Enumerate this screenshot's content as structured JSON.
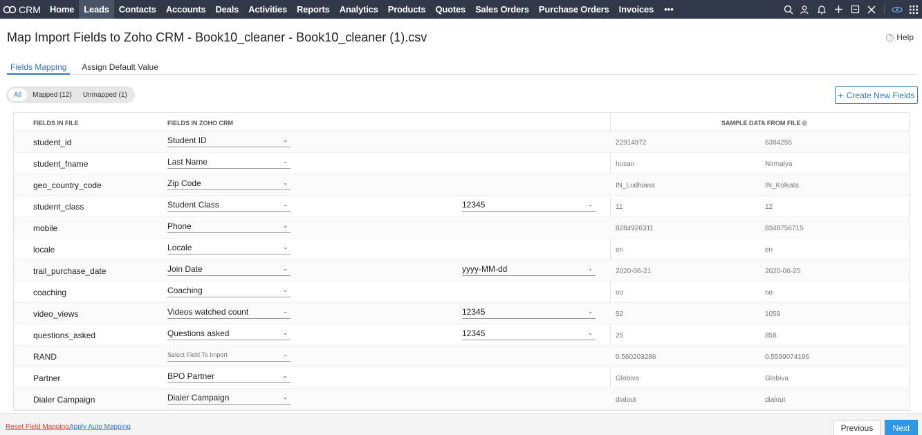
{
  "nav": {
    "brand": "CRM",
    "items": [
      {
        "label": "Home",
        "active": false
      },
      {
        "label": "Leads",
        "active": true
      },
      {
        "label": "Contacts",
        "active": false
      },
      {
        "label": "Accounts",
        "active": false
      },
      {
        "label": "Deals",
        "active": false
      },
      {
        "label": "Activities",
        "active": false
      },
      {
        "label": "Reports",
        "active": false
      },
      {
        "label": "Analytics",
        "active": false
      },
      {
        "label": "Products",
        "active": false
      },
      {
        "label": "Quotes",
        "active": false
      },
      {
        "label": "Sales Orders",
        "active": false
      },
      {
        "label": "Purchase Orders",
        "active": false
      },
      {
        "label": "Invoices",
        "active": false
      }
    ],
    "more": "•••",
    "icons": [
      "search-icon",
      "user-settings-icon",
      "bell-icon",
      "plus-icon",
      "calendar-icon",
      "tools-icon",
      "eye-link-icon",
      "apps-grid-icon"
    ]
  },
  "page": {
    "title": "Map Import Fields to Zoho CRM - Book10_cleaner - Book10_cleaner (1).csv",
    "help": "Help"
  },
  "tabs": [
    {
      "label": "Fields Mapping",
      "active": true
    },
    {
      "label": "Assign Default Value",
      "active": false
    }
  ],
  "filters": [
    {
      "label": "All",
      "active": true
    },
    {
      "label": "Mapped (12)",
      "active": false
    },
    {
      "label": "Unmapped (1)",
      "active": false
    }
  ],
  "create_button": "Create New Fields",
  "table": {
    "headers": {
      "file": "FIELDS IN FILE",
      "crm": "FIELDS IN ZOHO CRM",
      "sample": "SAMPLE DATA FROM FILE"
    },
    "rows": [
      {
        "file": "student_id",
        "crm": "Student ID",
        "format": "",
        "s1": "22914972",
        "s2": "6384255"
      },
      {
        "file": "student_fname",
        "crm": "Last Name",
        "format": "",
        "s1": "husan",
        "s2": "Nirmalya"
      },
      {
        "file": "geo_country_code",
        "crm": "Zip Code",
        "format": "",
        "s1": "IN_Ludhiana",
        "s2": "IN_Kolkata"
      },
      {
        "file": "student_class",
        "crm": "Student Class",
        "format": "12345",
        "s1": "11",
        "s2": "12"
      },
      {
        "file": "mobile",
        "crm": "Phone",
        "format": "",
        "s1": "8284926311",
        "s2": "8348756715"
      },
      {
        "file": "locale",
        "crm": "Locale",
        "format": "",
        "s1": "en",
        "s2": "en"
      },
      {
        "file": "trail_purchase_date",
        "crm": "Join Date",
        "format": "yyyy-MM-dd",
        "s1": "2020-06-21",
        "s2": "2020-06-25"
      },
      {
        "file": "coaching",
        "crm": "Coaching",
        "format": "",
        "s1": "no",
        "s2": "no"
      },
      {
        "file": "video_views",
        "crm": "Videos watched count",
        "format": "12345",
        "s1": "52",
        "s2": "1059"
      },
      {
        "file": "questions_asked",
        "crm": "Questions asked",
        "format": "12345",
        "s1": "25",
        "s2": "858"
      },
      {
        "file": "RAND",
        "crm": "",
        "placeholder": "Select Field To Import",
        "format": "",
        "s1": "0.560203286",
        "s2": "0.5599074196"
      },
      {
        "file": "Partner",
        "crm": "BPO Partner",
        "format": "",
        "s1": "Globiva",
        "s2": "Globiva"
      },
      {
        "file": "Dialer Campaign",
        "crm": "Dialer Campaign",
        "format": "",
        "s1": "dialout",
        "s2": "dialout"
      }
    ]
  },
  "footer": {
    "reset": "Reset Field Mapping",
    "auto": "Apply Auto Mapping",
    "previous": "Previous",
    "next": "Next"
  },
  "colors": {
    "nav_bg": "#313949",
    "accent": "#3576ba",
    "next_bg": "#2f96e8",
    "reset": "#e0383e"
  }
}
